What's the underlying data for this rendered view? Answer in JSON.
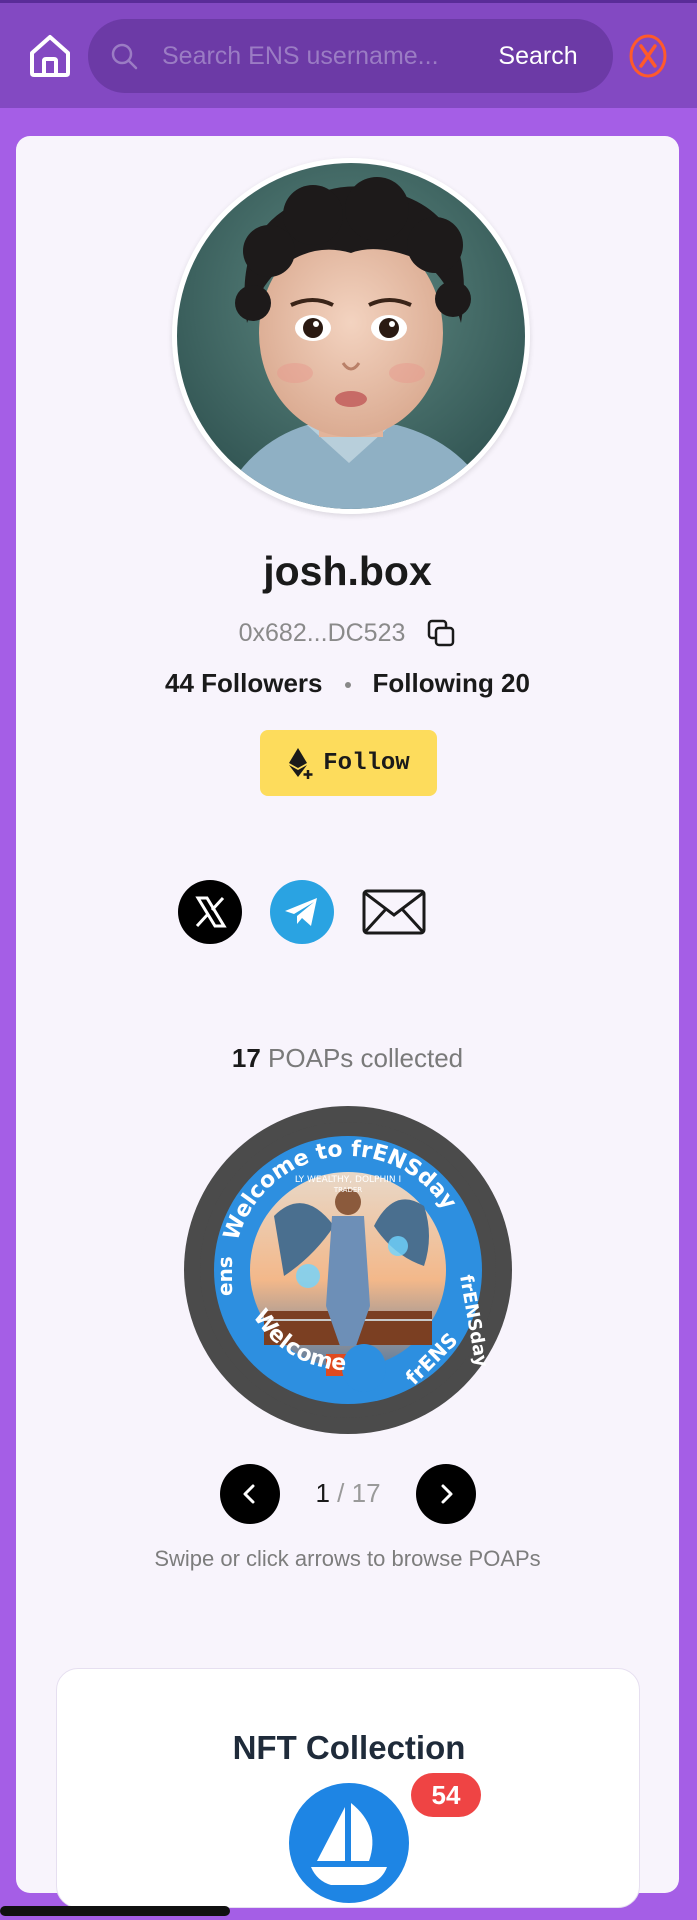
{
  "search": {
    "placeholder": "Search ENS username...",
    "button_label": "Search"
  },
  "profile": {
    "name": "josh.box",
    "address": "0x682...DC523",
    "followers_label": "44 Followers",
    "following_label": "Following 20",
    "follow_label": "Follow"
  },
  "socials": {
    "icons": [
      "x-icon",
      "telegram-icon",
      "mail-icon"
    ]
  },
  "poaps": {
    "count": "17",
    "count_suffix": "POAPs collected",
    "current": "1",
    "separator": "/",
    "total": "17",
    "hint": "Swipe or click arrows to browse POAPs",
    "ring_text_top": "Welcome to frENSday",
    "ring_text_right": "frENSday",
    "ring_text_bottom_left": "Welcome",
    "ring_text_bottom_right": "frENS",
    "ring_text_left": "ens",
    "inner_text": "LY WEALTHY, DOLPHIN I",
    "inner_text_2": "TRADER"
  },
  "nft": {
    "title": "NFT Collection",
    "count": "54"
  },
  "colors": {
    "topbar": "#8349c2",
    "page_bg": "#a55ee6",
    "follow_button": "#fddc5c",
    "badge": "#ef4444",
    "opensea": "#1e85e4",
    "telegram": "#2aa3e2",
    "wallet_accent": "#ff5a2b"
  }
}
